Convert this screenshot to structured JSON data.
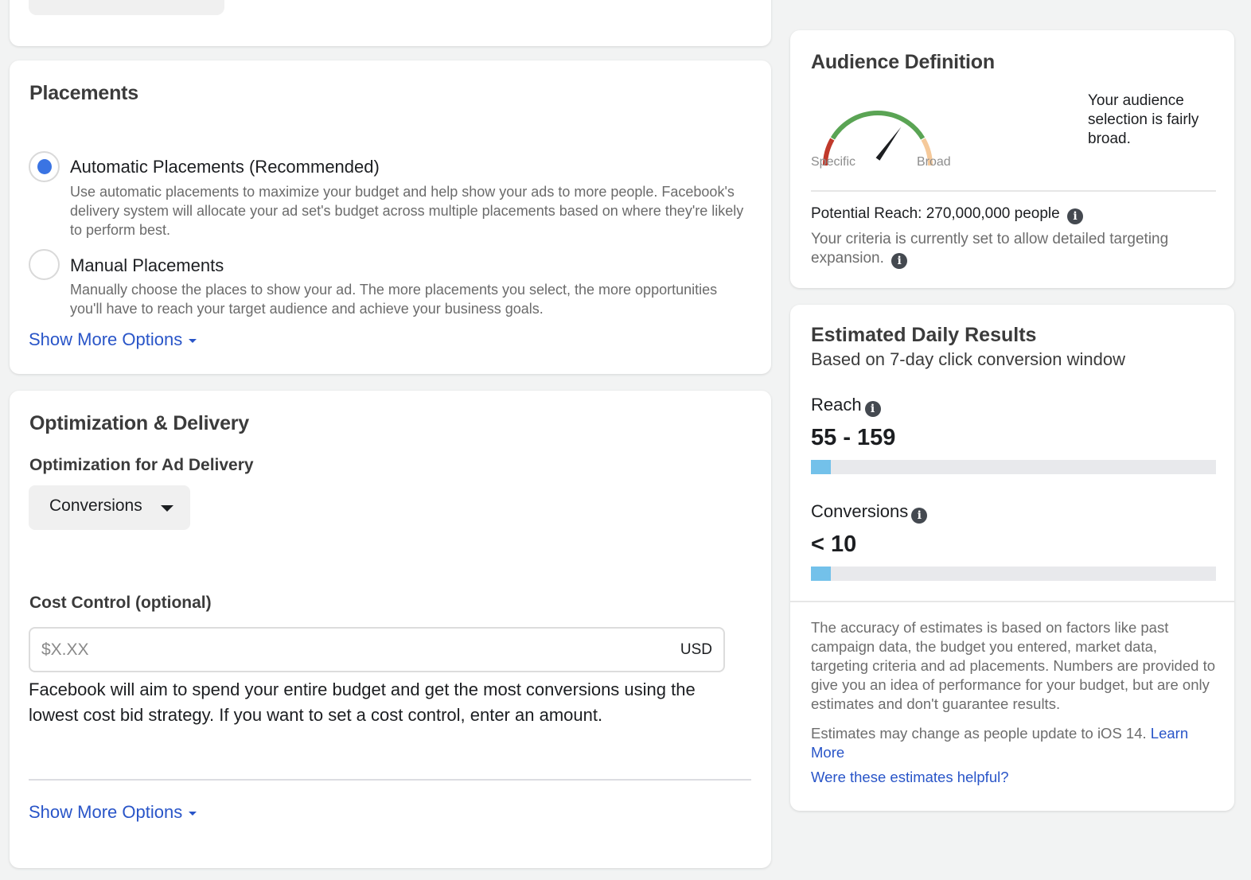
{
  "placements": {
    "title": "Placements",
    "options": [
      {
        "label": "Automatic Placements (Recommended)",
        "description": "Use automatic placements to maximize your budget and help show your ads to more people. Facebook's delivery system will allocate your ad set's budget across multiple placements based on where they're likely to perform best.",
        "selected": true
      },
      {
        "label": "Manual Placements",
        "description": "Manually choose the places to show your ad. The more placements you select, the more opportunities you'll have to reach your target audience and achieve your business goals.",
        "selected": false
      }
    ],
    "show_more": "Show More Options"
  },
  "optimization": {
    "title": "Optimization & Delivery",
    "ad_delivery_label": "Optimization for Ad Delivery",
    "ad_delivery_value": "Conversions",
    "cost_control_label": "Cost Control (optional)",
    "cost_control_value": "",
    "cost_control_placeholder": "$X.XX",
    "currency": "USD",
    "cost_control_help": "Facebook will aim to spend your entire budget and get the most conversions using the lowest cost bid strategy. If you want to set a cost control, enter an amount.",
    "show_more": "Show More Options"
  },
  "audience": {
    "title": "Audience Definition",
    "gauge_min_label": "Specific",
    "gauge_max_label": "Broad",
    "gauge_level": 0.7,
    "gauge_colors": {
      "specific": "#c0392b",
      "middle": "#5aa454",
      "broad": "#f5c99a",
      "needle": "#1c1e21"
    },
    "summary": "Your audience selection is fairly broad.",
    "potential_reach_label": "Potential Reach:",
    "potential_reach_value": "270,000,000 people",
    "expansion_note": "Your criteria is currently set to allow detailed targeting expansion."
  },
  "results": {
    "title": "Estimated Daily Results",
    "subtitle": "Based on 7-day click conversion window",
    "metrics": [
      {
        "label": "Reach",
        "value": "55 - 159",
        "fill_fraction": 0.05
      },
      {
        "label": "Conversions",
        "value": "< 10",
        "fill_fraction": 0.05
      }
    ],
    "bar_color": "#73c1ea",
    "accuracy_note": "The accuracy of estimates is based on factors like past campaign data, the budget you entered, market data, targeting criteria and ad placements. Numbers are provided to give you an idea of performance for your budget, but are only estimates and don't guarantee results.",
    "ios_note": "Estimates may change as people update to iOS 14.",
    "learn_more": "Learn More",
    "feedback_link": "Were these estimates helpful?"
  }
}
